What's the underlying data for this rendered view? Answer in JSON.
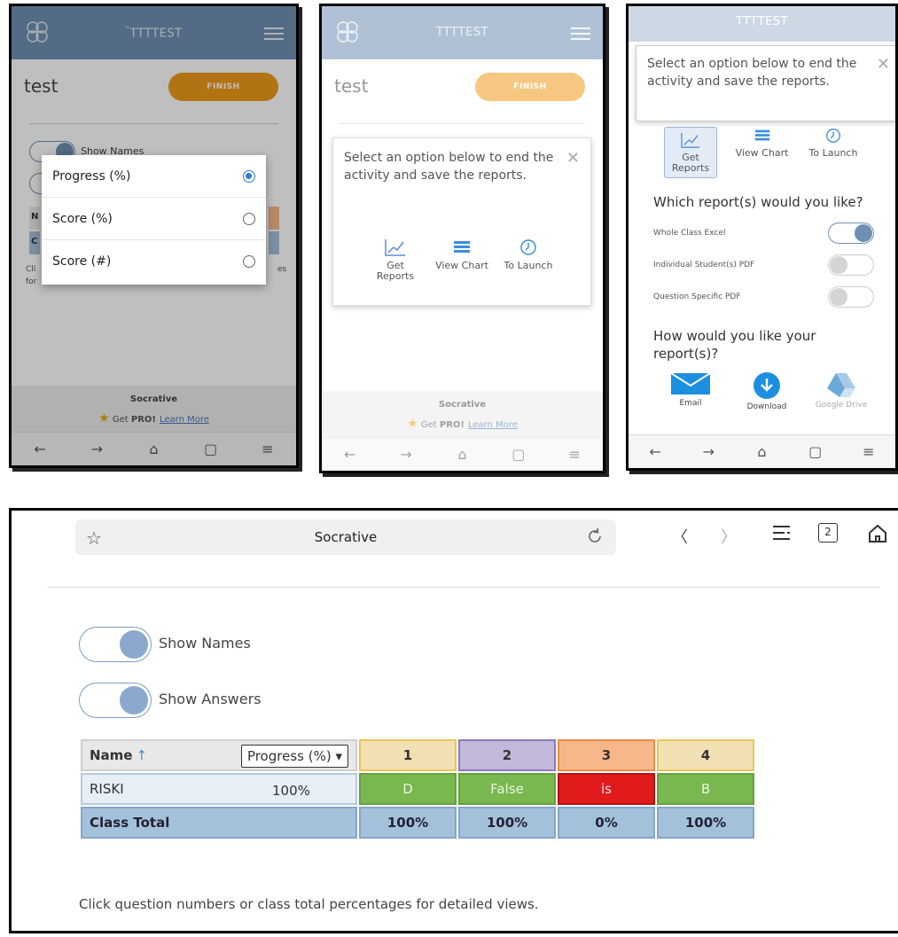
{
  "phone1": {
    "brand": "TTTTEST",
    "test_title": "test",
    "finish": "FINISH",
    "show_names": "Show Names",
    "dropdown": [
      "Progress (%)",
      "Score (%)",
      "Score (#)"
    ],
    "selected_option": "Progress (%)",
    "hint_frag_left_1": "Cli",
    "hint_frag_left_2": "for",
    "hint_frag_right": "es",
    "table_frag_1": "N",
    "table_frag_2": "C",
    "footer_brand": "Socrative",
    "get": "Get",
    "pro": "PRO!",
    "learn_more": "Learn More"
  },
  "phone2": {
    "brand": "TTTTEST",
    "test_title": "test",
    "finish": "FINISH",
    "dialog_text": "Select an option below to end the activity and save the reports.",
    "options": [
      "Get Reports",
      "View Chart",
      "To Launch"
    ],
    "footer_brand": "Socrative",
    "get": "Get",
    "pro": "PRO!",
    "learn_more": "Learn More"
  },
  "phone3": {
    "brand": "TTTTEST",
    "dialog_text": "Select an option below to end the activity and save the reports.",
    "options": [
      "Get Reports",
      "View Chart",
      "To Launch"
    ],
    "which_report": "Which report(s) would you like?",
    "reports": [
      {
        "label": "Whole Class Excel",
        "on": true
      },
      {
        "label": "Individual Student(s) PDF",
        "on": false
      },
      {
        "label": "Question Specific PDF",
        "on": false
      }
    ],
    "how_report": "How would you like your report(s)?",
    "share": [
      "Email",
      "Download",
      "Google Drive"
    ]
  },
  "browser": {
    "title": "Socrative",
    "tab_count": "2",
    "show_names": "Show Names",
    "show_answers": "Show Answers",
    "table": {
      "name_header": "Name",
      "metric_select": "Progress (%)",
      "questions": [
        "1",
        "2",
        "3",
        "4"
      ],
      "students": [
        {
          "name": "RISKI",
          "progress": "100%",
          "answers": [
            "D",
            "False",
            "is",
            "B"
          ],
          "correct": [
            true,
            true,
            false,
            true
          ]
        }
      ],
      "class_total_label": "Class Total",
      "class_totals": [
        "100%",
        "100%",
        "0%",
        "100%"
      ]
    },
    "hint": "Click question numbers or class total percentages for detailed views."
  },
  "colors": {
    "brand_blue": "#6f8fb3",
    "finish_orange": "#ee9a1a",
    "correct_green": "#78b84e",
    "wrong_red": "#e11b1b",
    "total_blue": "#a4c1dc"
  }
}
